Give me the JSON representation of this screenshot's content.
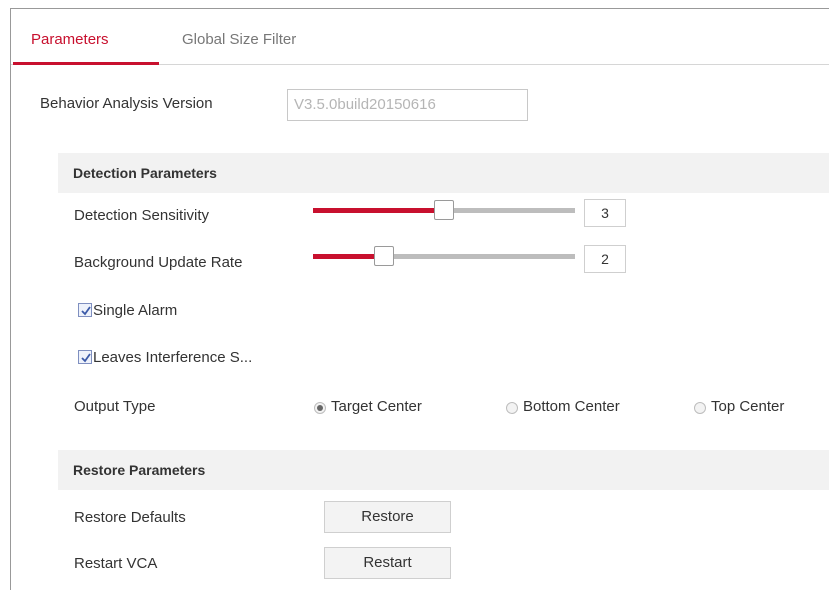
{
  "tabs": [
    {
      "label": "Parameters",
      "active": true
    },
    {
      "label": "Global Size Filter",
      "active": false
    }
  ],
  "version": {
    "label": "Behavior Analysis Version",
    "value": "V3.5.0build20150616"
  },
  "detection": {
    "header": "Detection Parameters",
    "sensitivity": {
      "label": "Detection Sensitivity",
      "value": "3",
      "min": 1,
      "max": 5
    },
    "background_update": {
      "label": "Background Update Rate",
      "value": "2",
      "min": 1,
      "max": 5
    },
    "single_alarm": {
      "label": "Single Alarm",
      "checked": true
    },
    "leaves_interference": {
      "label": "Leaves Interference S...",
      "checked": true
    },
    "output_type": {
      "label": "Output Type",
      "options": [
        "Target Center",
        "Bottom Center",
        "Top Center"
      ],
      "selected": "Target Center"
    }
  },
  "restore": {
    "header": "Restore Parameters",
    "defaults": {
      "label": "Restore Defaults",
      "button": "Restore"
    },
    "restart": {
      "label": "Restart VCA",
      "button": "Restart"
    }
  },
  "colors": {
    "accent": "#c8102e",
    "track": "#bdbdbd",
    "section_bg": "#f2f2f2"
  }
}
